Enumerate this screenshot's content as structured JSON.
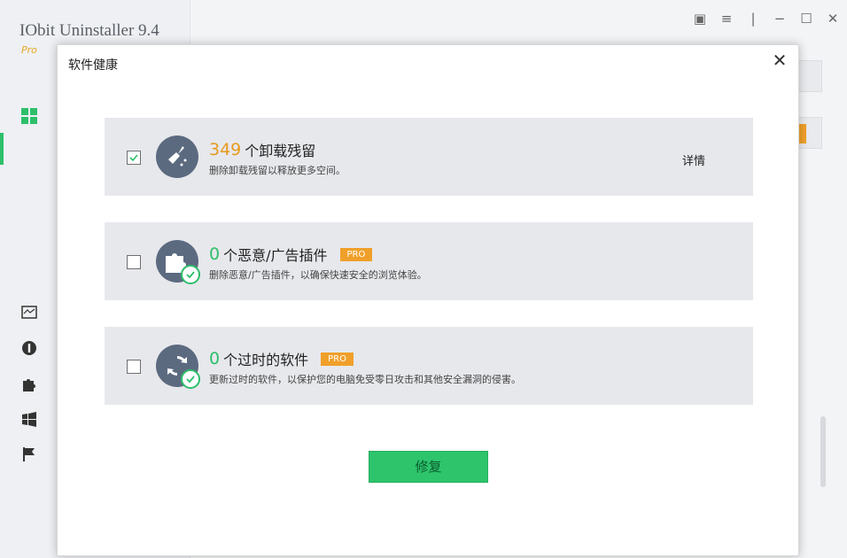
{
  "app": {
    "title": "IObit Uninstaller 9.4",
    "edition": "Pro"
  },
  "dialog": {
    "title": "软件健康",
    "close_icon": "close-icon"
  },
  "items": [
    {
      "checked": true,
      "count": "349",
      "label": "个卸载残留",
      "description": "删除卸载残留以释放更多空间。",
      "detail": "详情",
      "icon": "broom-icon",
      "count_color": "#e69a1f"
    },
    {
      "checked": false,
      "count": "0",
      "label": "个恶意/广告插件",
      "pro": "PRO",
      "description": "删除恶意/广告插件，以确保快速安全的浏览体验。",
      "icon": "puzzle-icon",
      "count_color": "#2dbf6a"
    },
    {
      "checked": false,
      "count": "0",
      "label": "个过时的软件",
      "pro": "PRO",
      "description": "更新过时的软件，以保护您的电脑免受零日攻击和其他安全漏洞的侵害。",
      "icon": "refresh-icon",
      "count_color": "#2dbf6a"
    }
  ],
  "repair_button": "修复",
  "colors": {
    "accent_green": "#2dc46c",
    "pro_orange": "#f0a02a",
    "card_bg": "#e7e8ec"
  }
}
